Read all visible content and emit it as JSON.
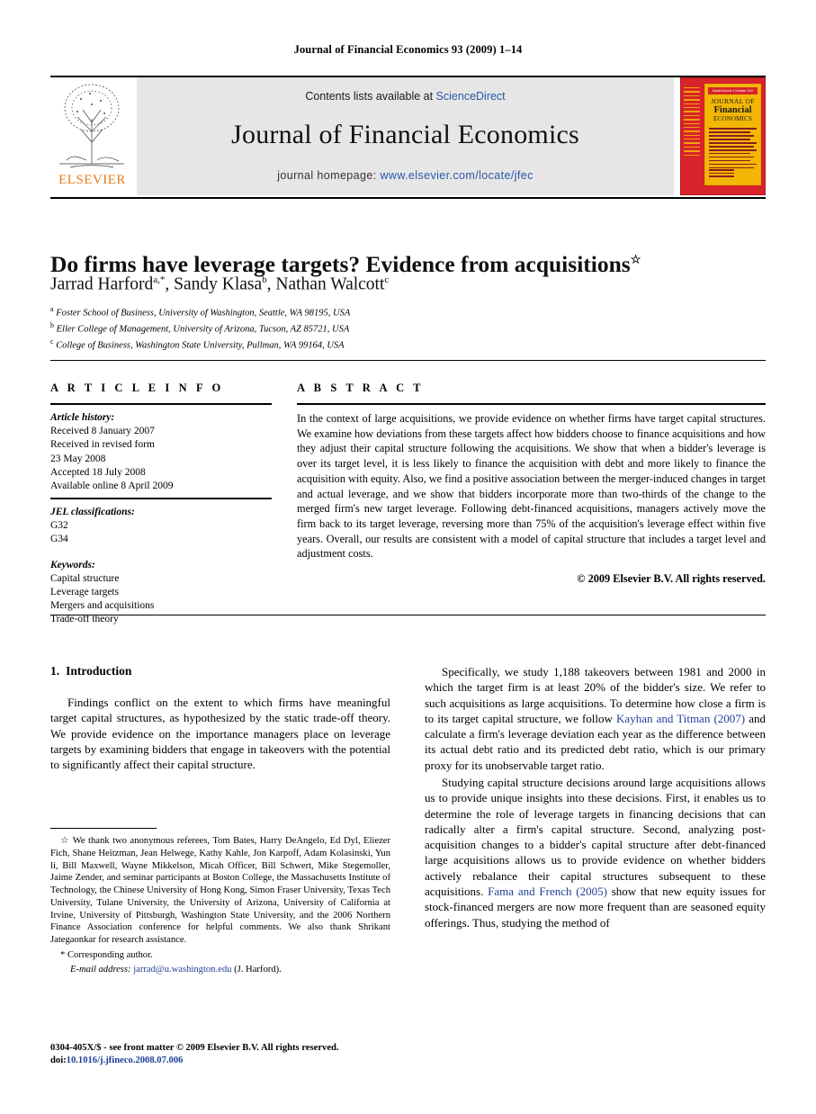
{
  "running_head": "Journal of Financial Economics 93 (2009) 1–14",
  "banner": {
    "contents_prefix": "Contents lists available at ",
    "contents_link": "ScienceDirect",
    "journal_title": "Journal of Financial Economics",
    "homepage_prefix": "journal homepage: ",
    "homepage_url": "www.elsevier.com/locate/jfec",
    "publisher_name": "ELSEVIER",
    "publisher_color": "#e87b1e",
    "link_color": "#2b57a5",
    "banner_bg": "#e6e6e6"
  },
  "cover": {
    "topbar": "March/Volume 1 Number XXX",
    "line1": "JOURNAL OF",
    "line2": "Financial",
    "line3": "ECONOMICS",
    "bg_color": "#d8232a",
    "panel_color": "#f2b705"
  },
  "article": {
    "title": "Do firms have leverage targets? Evidence from acquisitions",
    "title_footnote_marker": "☆",
    "authors": "Jarrad Harford a,*, Sandy Klasa b, Nathan Walcott c",
    "affiliations": [
      "Foster School of Business, University of Washington, Seattle, WA 98195, USA",
      "Eller College of Management, University of Arizona, Tucson, AZ 85721, USA",
      "College of Business, Washington State University, Pullman, WA 99164, USA"
    ],
    "affiliation_markers": [
      "a",
      "b",
      "c"
    ]
  },
  "article_info": {
    "heading": "A R T I C L E   I N F O",
    "history_label": "Article history:",
    "history": [
      "Received 8 January 2007",
      "Received in revised form",
      "23 May 2008",
      "Accepted 18 July 2008",
      "Available online 8 April 2009"
    ],
    "jel_label": "JEL classifications:",
    "jel": [
      "G32",
      "G34"
    ],
    "keywords_label": "Keywords:",
    "keywords": [
      "Capital structure",
      "Leverage targets",
      "Mergers and acquisitions",
      "Trade-off theory"
    ]
  },
  "abstract": {
    "heading": "A B S T R A C T",
    "text": "In the context of large acquisitions, we provide evidence on whether firms have target capital structures. We examine how deviations from these targets affect how bidders choose to finance acquisitions and how they adjust their capital structure following the acquisitions. We show that when a bidder's leverage is over its target level, it is less likely to finance the acquisition with debt and more likely to finance the acquisition with equity. Also, we find a positive association between the merger-induced changes in target and actual leverage, and we show that bidders incorporate more than two-thirds of the change to the merged firm's new target leverage. Following debt-financed acquisitions, managers actively move the firm back to its target leverage, reversing more than 75% of the acquisition's leverage effect within five years. Overall, our results are consistent with a model of capital structure that includes a target level and adjustment costs.",
    "copyright": "© 2009 Elsevier B.V. All rights reserved."
  },
  "intro": {
    "number": "1.",
    "heading": "Introduction",
    "para1": "Findings conflict on the extent to which firms have meaningful target capital structures, as hypothesized by the static trade-off theory. We provide evidence on the importance managers place on leverage targets by examining bidders that engage in takeovers with the potential to significantly affect their capital structure.",
    "para2_a": "Specifically, we study 1,188 takeovers between 1981 and 2000 in which the target firm is at least 20% of the bidder's size. We refer to such acquisitions as large acquisitions. To determine how close a firm is to its target capital structure, we follow ",
    "para2_cite": "Kayhan and Titman (2007)",
    "para2_b": " and calculate a firm's leverage deviation each year as the difference between its actual debt ratio and its predicted debt ratio, which is our primary proxy for its unobservable target ratio.",
    "para3_a": "Studying capital structure decisions around large acquisitions allows us to provide unique insights into these decisions. First, it enables us to determine the role of leverage targets in financing decisions that can radically alter a firm's capital structure. Second, analyzing post-acquisition changes to a bidder's capital structure after debt-financed large acquisitions allows us to provide evidence on whether bidders actively rebalance their capital structures subsequent to these acquisitions. ",
    "para3_cite": "Fama and French (2005)",
    "para3_b": " show that new equity issues for stock-financed mergers are now more frequent than are seasoned equity offerings. Thus, studying the method of"
  },
  "footnotes": {
    "star_marker": "☆",
    "star_text": "We thank two anonymous referees, Tom Bates, Harry DeAngelo, Ed Dyl, Eliezer Fich, Shane Heitzman, Jean Helwege, Kathy Kahle, Jon Karpoff, Adam Kolasinski, Yun li, Bill Maxwell, Wayne Mikkelson, Micah Officer, Bill Schwert, Mike Stegemoller, Jaime Zender, and seminar participants at Boston College, the Massachusetts Institute of Technology, the Chinese University of Hong Kong, Simon Fraser University, Texas Tech University, Tulane University, the University of Arizona, University of California at Irvine, University of Pittsburgh, Washington State University, and the 2006 Northern Finance Association conference for helpful comments. We also thank Shrikant Jategaonkar for research assistance.",
    "corresponding_marker": "*",
    "corresponding_text": "Corresponding author.",
    "email_label": "E-mail address:",
    "email": "jarrad@u.washington.edu",
    "email_suffix": "(J. Harford)."
  },
  "footer": {
    "issn_line": "0304-405X/$ - see front matter © 2009 Elsevier B.V. All rights reserved.",
    "doi_label": "doi:",
    "doi": "10.1016/j.jfineco.2008.07.006"
  }
}
